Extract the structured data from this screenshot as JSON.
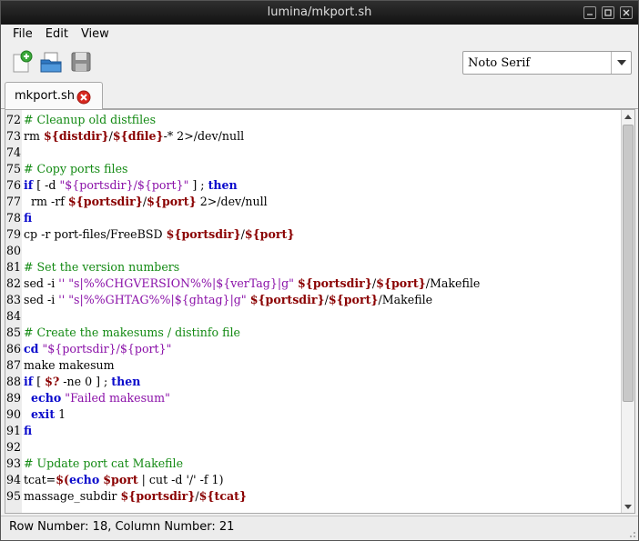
{
  "window": {
    "title": "lumina/mkport.sh"
  },
  "menu": [
    "File",
    "Edit",
    "View"
  ],
  "toolbar": {
    "icons": [
      "new-file-icon",
      "open-folder-icon",
      "save-icon"
    ],
    "font_value": "Noto Serif"
  },
  "tab": {
    "label": "mkport.sh"
  },
  "lines": [
    {
      "n": "72",
      "segs": [
        [
          "c",
          "# Cleanup old distfiles"
        ]
      ]
    },
    {
      "n": "73",
      "segs": [
        [
          "p",
          "rm "
        ],
        [
          "v",
          "${distdir}"
        ],
        [
          "p",
          "/"
        ],
        [
          "v",
          "${dfile}"
        ],
        [
          "p",
          "-* 2>/dev/null"
        ]
      ]
    },
    {
      "n": "74",
      "segs": []
    },
    {
      "n": "75",
      "segs": [
        [
          "c",
          "# Copy ports files"
        ]
      ]
    },
    {
      "n": "76",
      "segs": [
        [
          "k",
          "if"
        ],
        [
          "p",
          " [ -d "
        ],
        [
          "s",
          "\"${portsdir}/${port}\""
        ],
        [
          "p",
          " ] ; "
        ],
        [
          "k",
          "then"
        ]
      ]
    },
    {
      "n": "77",
      "segs": [
        [
          "p",
          "  rm -rf "
        ],
        [
          "v",
          "${portsdir}"
        ],
        [
          "p",
          "/"
        ],
        [
          "v",
          "${port}"
        ],
        [
          "p",
          " 2>/dev/null"
        ]
      ]
    },
    {
      "n": "78",
      "segs": [
        [
          "k",
          "fi"
        ]
      ]
    },
    {
      "n": "79",
      "segs": [
        [
          "p",
          "cp -r port-files/FreeBSD "
        ],
        [
          "v",
          "${portsdir}"
        ],
        [
          "p",
          "/"
        ],
        [
          "v",
          "${port}"
        ]
      ]
    },
    {
      "n": "80",
      "segs": []
    },
    {
      "n": "81",
      "segs": [
        [
          "c",
          "# Set the version numbers"
        ]
      ]
    },
    {
      "n": "82",
      "segs": [
        [
          "p",
          "sed -i "
        ],
        [
          "s",
          "'' \"s|%%CHGVERSION%%|${verTag}|g\""
        ],
        [
          "p",
          " "
        ],
        [
          "v",
          "${portsdir}"
        ],
        [
          "p",
          "/"
        ],
        [
          "v",
          "${port}"
        ],
        [
          "p",
          "/Makefile"
        ]
      ]
    },
    {
      "n": "83",
      "segs": [
        [
          "p",
          "sed -i "
        ],
        [
          "s",
          "'' \"s|%%GHTAG%%|${ghtag}|g\""
        ],
        [
          "p",
          " "
        ],
        [
          "v",
          "${portsdir}"
        ],
        [
          "p",
          "/"
        ],
        [
          "v",
          "${port}"
        ],
        [
          "p",
          "/Makefile"
        ]
      ]
    },
    {
      "n": "84",
      "segs": []
    },
    {
      "n": "85",
      "segs": [
        [
          "c",
          "# Create the makesums / distinfo file"
        ]
      ]
    },
    {
      "n": "86",
      "segs": [
        [
          "k",
          "cd"
        ],
        [
          "p",
          " "
        ],
        [
          "s",
          "\"${portsdir}/${port}\""
        ]
      ]
    },
    {
      "n": "87",
      "segs": [
        [
          "p",
          "make makesum"
        ]
      ]
    },
    {
      "n": "88",
      "segs": [
        [
          "k",
          "if"
        ],
        [
          "p",
          " [ "
        ],
        [
          "v",
          "$?"
        ],
        [
          "p",
          " -ne 0 ] ; "
        ],
        [
          "k",
          "then"
        ]
      ]
    },
    {
      "n": "89",
      "segs": [
        [
          "p",
          "  "
        ],
        [
          "k",
          "echo"
        ],
        [
          "p",
          " "
        ],
        [
          "s",
          "\"Failed makesum\""
        ]
      ]
    },
    {
      "n": "90",
      "segs": [
        [
          "p",
          "  "
        ],
        [
          "k",
          "exit"
        ],
        [
          "p",
          " 1"
        ]
      ]
    },
    {
      "n": "91",
      "segs": [
        [
          "k",
          "fi"
        ]
      ]
    },
    {
      "n": "92",
      "segs": []
    },
    {
      "n": "93",
      "segs": [
        [
          "c",
          "# Update port cat Makefile"
        ]
      ]
    },
    {
      "n": "94",
      "segs": [
        [
          "p",
          "tcat="
        ],
        [
          "v",
          "$("
        ],
        [
          "k",
          "echo"
        ],
        [
          "p",
          " "
        ],
        [
          "v",
          "$port"
        ],
        [
          "p",
          " | cut -d '/' -f 1)"
        ]
      ]
    },
    {
      "n": "95",
      "segs": [
        [
          "p",
          "massage_subdir "
        ],
        [
          "v",
          "${portsdir}"
        ],
        [
          "p",
          "/"
        ],
        [
          "v",
          "${tcat}"
        ]
      ]
    }
  ],
  "status": {
    "text": "Row Number: 18, Column Number: 21"
  }
}
